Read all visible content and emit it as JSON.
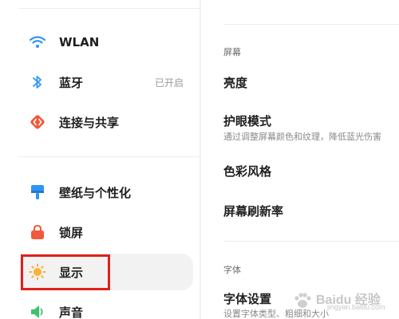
{
  "sidebar": {
    "items": [
      {
        "label": "WLAN",
        "status": "",
        "icon": "wifi-icon",
        "color": "#2f95f5"
      },
      {
        "label": "蓝牙",
        "status": "已开启",
        "icon": "bluetooth-icon",
        "color": "#2f95f5"
      },
      {
        "label": "连接与共享",
        "status": "",
        "icon": "connection-share-icon",
        "color": "#f1593b"
      },
      {
        "label": "壁纸与个性化",
        "status": "",
        "icon": "wallpaper-icon",
        "color": "#2f95f5"
      },
      {
        "label": "锁屏",
        "status": "",
        "icon": "lock-icon",
        "color": "#f1593b"
      },
      {
        "label": "显示",
        "status": "",
        "icon": "sun-icon",
        "color": "#f8b334",
        "active": true
      },
      {
        "label": "声音",
        "status": "",
        "icon": "speaker-icon",
        "color": "#3ac46a"
      }
    ]
  },
  "main": {
    "sections": [
      {
        "title": "屏幕",
        "items": [
          {
            "title": "亮度",
            "desc": ""
          },
          {
            "title": "护眼模式",
            "desc": "通过调整屏幕颜色和纹理，降低蓝光伤害"
          },
          {
            "title": "色彩风格",
            "desc": ""
          },
          {
            "title": "屏幕刷新率",
            "desc": ""
          }
        ]
      },
      {
        "title": "字体",
        "items": [
          {
            "title": "字体设置",
            "desc": "设置字体类型、粗细和大小"
          }
        ]
      }
    ]
  },
  "watermark": {
    "text": "Baidu 经验",
    "sub": "jingyan.baidu.com"
  },
  "colors": {
    "highlight": "#e0201a",
    "active_bg": "#f2f2f2"
  }
}
